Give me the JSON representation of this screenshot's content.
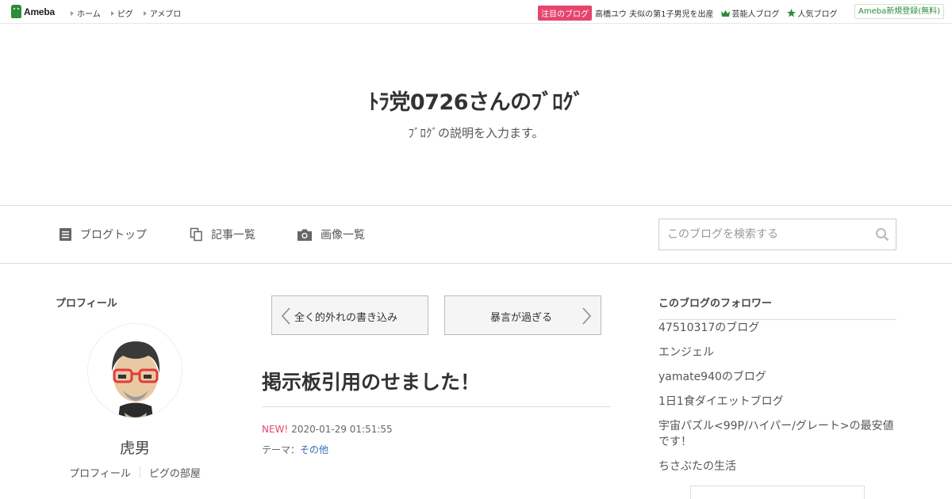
{
  "topbar": {
    "logo": "Ameba",
    "nav": [
      "ホーム",
      "ピグ",
      "アメブロ"
    ],
    "badge": "注目のブログ",
    "spotlight": "高橋ユウ 夫似の第1子男児を出産",
    "links": [
      "芸能人ブログ",
      "人気ブログ"
    ],
    "register": "Ameba新規登録(無料)"
  },
  "header": {
    "title": "ﾄﾗ党0726さんのﾌﾞﾛｸﾞ",
    "description": "ﾌﾞﾛｸﾞの説明を入力ます。"
  },
  "blognav": {
    "items": [
      "ブログトップ",
      "記事一覧",
      "画像一覧"
    ],
    "search_placeholder": "このブログを検索する"
  },
  "profile": {
    "title": "プロフィール",
    "name": "虎男",
    "links": [
      "プロフィール",
      "ピグの部屋"
    ]
  },
  "pager": {
    "prev": "全く的外れの書き込み",
    "next": "暴言が過ぎる"
  },
  "article": {
    "title": "掲示板引用のせました！",
    "new_label": "NEW!",
    "datetime": "2020-01-29 01:51:55",
    "theme_label": "テーマ：",
    "theme": "その他"
  },
  "followers": {
    "title": "このブログのフォロワー",
    "items": [
      "47510317のブログ",
      "エンジェル",
      "yamate940のブログ",
      "1日1食ダイエットブログ",
      "宇宙パズル<99P/ハイパー/グレート>の最安値です！",
      "ちさぶたの生活"
    ]
  },
  "colors": {
    "accent": "#e5456d",
    "brand_green": "#2d8c3c",
    "link": "#3a6db5"
  }
}
